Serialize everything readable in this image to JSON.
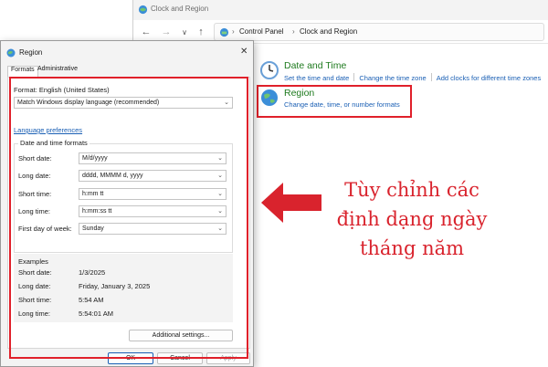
{
  "control_panel": {
    "window_title": "Clock and Region",
    "breadcrumbs": [
      "Control Panel",
      "Clock and Region"
    ],
    "nav_icons": [
      "back-arrow-icon",
      "forward-arrow-icon",
      "chevron-down-icon",
      "up-arrow-icon"
    ],
    "categories": [
      {
        "title": "Date and Time",
        "icon": "clock-icon",
        "links": [
          "Set the time and date",
          "Change the time zone",
          "Add clocks for different time zones"
        ]
      },
      {
        "title": "Region",
        "icon": "globe-icon",
        "links": [
          "Change date, time, or number formats"
        ]
      }
    ]
  },
  "annotation": {
    "lines": [
      "Tùy chỉnh các",
      "định dạng ngày",
      "tháng năm"
    ],
    "color": "#d9232d"
  },
  "region_dialog": {
    "title": "Region",
    "close_symbol": "✕",
    "tabs": [
      "Formats",
      "Administrative"
    ],
    "format_label": "Format: English (United States)",
    "format_select": "Match Windows display language (recommended)",
    "language_link": "Language preferences",
    "date_time_formats": {
      "group_label": "Date and time formats",
      "rows": [
        {
          "label": "Short date:",
          "value": "M/d/yyyy"
        },
        {
          "label": "Long date:",
          "value": "dddd, MMMM d, yyyy"
        },
        {
          "label": "Short time:",
          "value": "h:mm tt"
        },
        {
          "label": "Long time:",
          "value": "h:mm:ss tt"
        },
        {
          "label": "First day of week:",
          "value": "Sunday"
        }
      ]
    },
    "examples": {
      "group_label": "Examples",
      "rows": [
        {
          "label": "Short date:",
          "value": "1/3/2025"
        },
        {
          "label": "Long date:",
          "value": "Friday, January 3, 2025"
        },
        {
          "label": "Short time:",
          "value": "5:54 AM"
        },
        {
          "label": "Long time:",
          "value": "5:54:01 AM"
        }
      ]
    },
    "additional_settings_button": "Additional settings...",
    "ok_button": "OK",
    "cancel_button": "Cancel",
    "apply_button": "Apply"
  },
  "colors": {
    "highlight": "#e0202a",
    "link": "#1a5fb4",
    "category_title": "#1e7a1e"
  }
}
